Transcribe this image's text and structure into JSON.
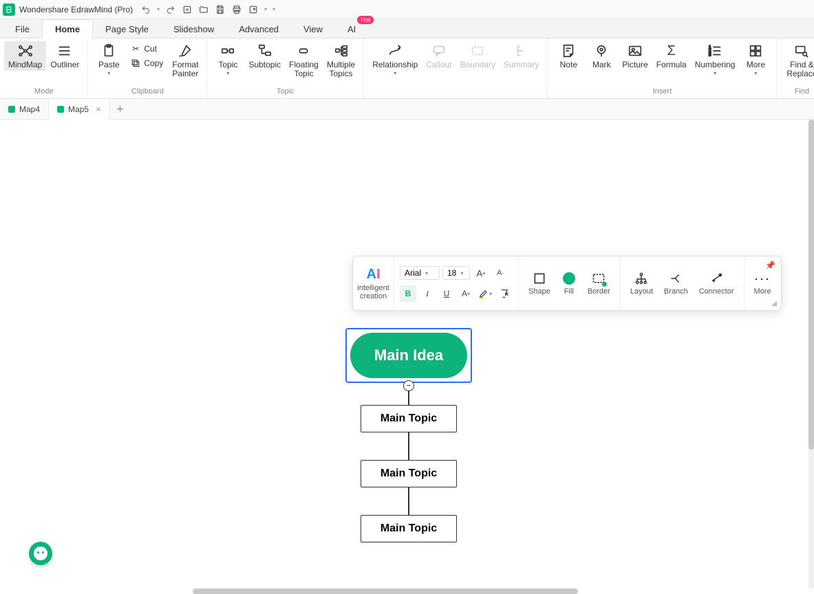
{
  "titlebar": {
    "app_title": "Wondershare EdrawMind (Pro)"
  },
  "menu": {
    "tabs": [
      "File",
      "Home",
      "Page Style",
      "Slideshow",
      "Advanced",
      "View",
      "AI"
    ],
    "active_index": 1,
    "hot_badge": "Hot"
  },
  "ribbon": {
    "mode": {
      "mindmap": "MindMap",
      "outliner": "Outliner",
      "label": "Mode"
    },
    "clipboard": {
      "paste": "Paste",
      "cut": "Cut",
      "copy": "Copy",
      "format_painter": "Format\nPainter",
      "label": "Clipboard"
    },
    "topic": {
      "topic": "Topic",
      "subtopic": "Subtopic",
      "floating": "Floating\nTopic",
      "multiple": "Multiple\nTopics",
      "label": "Topic"
    },
    "relate": {
      "relationship": "Relationship",
      "callout": "Callout",
      "boundary": "Boundary",
      "summary": "Summary"
    },
    "insert": {
      "note": "Note",
      "mark": "Mark",
      "picture": "Picture",
      "formula": "Formula",
      "numbering": "Numbering",
      "more": "More",
      "label": "Insert"
    },
    "find": {
      "find_replace": "Find &\nReplace",
      "label": "Find"
    }
  },
  "doctabs": {
    "tabs": [
      "Map4",
      "Map5"
    ],
    "active_index": 1
  },
  "minitool": {
    "ai_label": "intelligent\ncreation",
    "font_name": "Arial",
    "font_size": "18",
    "bold": "B",
    "italic": "I",
    "underline": "U",
    "shape": "Shape",
    "fill": "Fill",
    "border": "Border",
    "layout": "Layout",
    "branch": "Branch",
    "connector": "Connector",
    "more": "More"
  },
  "nodes": {
    "root": "Main Idea",
    "children": [
      "Main Topic",
      "Main Topic",
      "Main Topic"
    ]
  }
}
